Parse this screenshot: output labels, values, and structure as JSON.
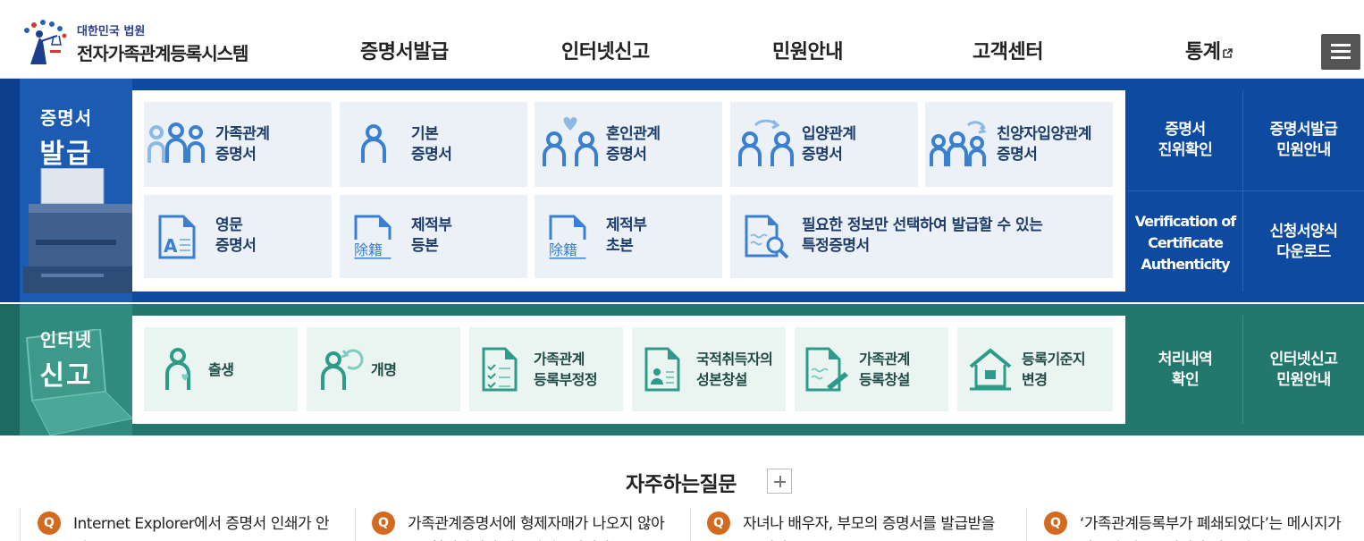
{
  "header": {
    "logo_sub": "대한민국 법원",
    "logo_title": "전자가족관계등록시스템",
    "nav": [
      "증명서발급",
      "인터넷신고",
      "민원안내",
      "고객센터",
      "통계"
    ]
  },
  "cert": {
    "title_small": "증명서",
    "title_big": "발급",
    "tiles": [
      {
        "line1": "가족관계",
        "line2": "증명서"
      },
      {
        "line1": "기본",
        "line2": "증명서"
      },
      {
        "line1": "혼인관계",
        "line2": "증명서"
      },
      {
        "line1": "입양관계",
        "line2": "증명서"
      },
      {
        "line1": "친양자입양관계",
        "line2": "증명서"
      },
      {
        "line1": "영문",
        "line2": "증명서"
      },
      {
        "line1": "제적부",
        "line2": "등본"
      },
      {
        "line1": "제적부",
        "line2": "초본"
      },
      {
        "line1": "필요한 정보만 선택하여 발급할 수 있는",
        "line2": "특정증명서"
      }
    ],
    "side": [
      {
        "line1": "증명서",
        "line2": "진위확인"
      },
      {
        "line1": "증명서발급",
        "line2": "민원안내"
      },
      {
        "line1": "Verification of",
        "line2": "Certificate",
        "line3": "Authenticity"
      },
      {
        "line1": "신청서양식",
        "line2": "다운로드"
      }
    ],
    "hanja": "除籍"
  },
  "net": {
    "title_small": "인터넷",
    "title_big": "신고",
    "tiles": [
      {
        "line1": "출생"
      },
      {
        "line1": "개명"
      },
      {
        "line1": "가족관계",
        "line2": "등록부정정"
      },
      {
        "line1": "국적취득자의",
        "line2": "성본창설"
      },
      {
        "line1": "가족관계",
        "line2": "등록창설"
      },
      {
        "line1": "등록기준지",
        "line2": "변경"
      }
    ],
    "side": [
      {
        "line1": "처리내역",
        "line2": "확인"
      },
      {
        "line1": "인터넷신고",
        "line2": "민원안내"
      }
    ]
  },
  "faq": {
    "title": "자주하는질문",
    "q_mark": "Q",
    "items": [
      "Internet Explorer에서 증명서 인쇄가 안돼요.",
      "가족관계증명서에 형제자매가 나오지 않아요. 형제자매의 가족관계증명서가",
      "자녀나 배우자, 부모의 증명서를 발급받을 수 있나요",
      "‘가족관계등록부가 폐쇄되었다’는 메시지가 나오며 영문증명서가 발급이"
    ]
  },
  "colors": {
    "cert_band": "#0d4aa0",
    "net_band": "#22786c",
    "cert_icon": "#3a7fd0",
    "net_icon": "#2d9b8a",
    "faq_q": "#d26a1f"
  }
}
